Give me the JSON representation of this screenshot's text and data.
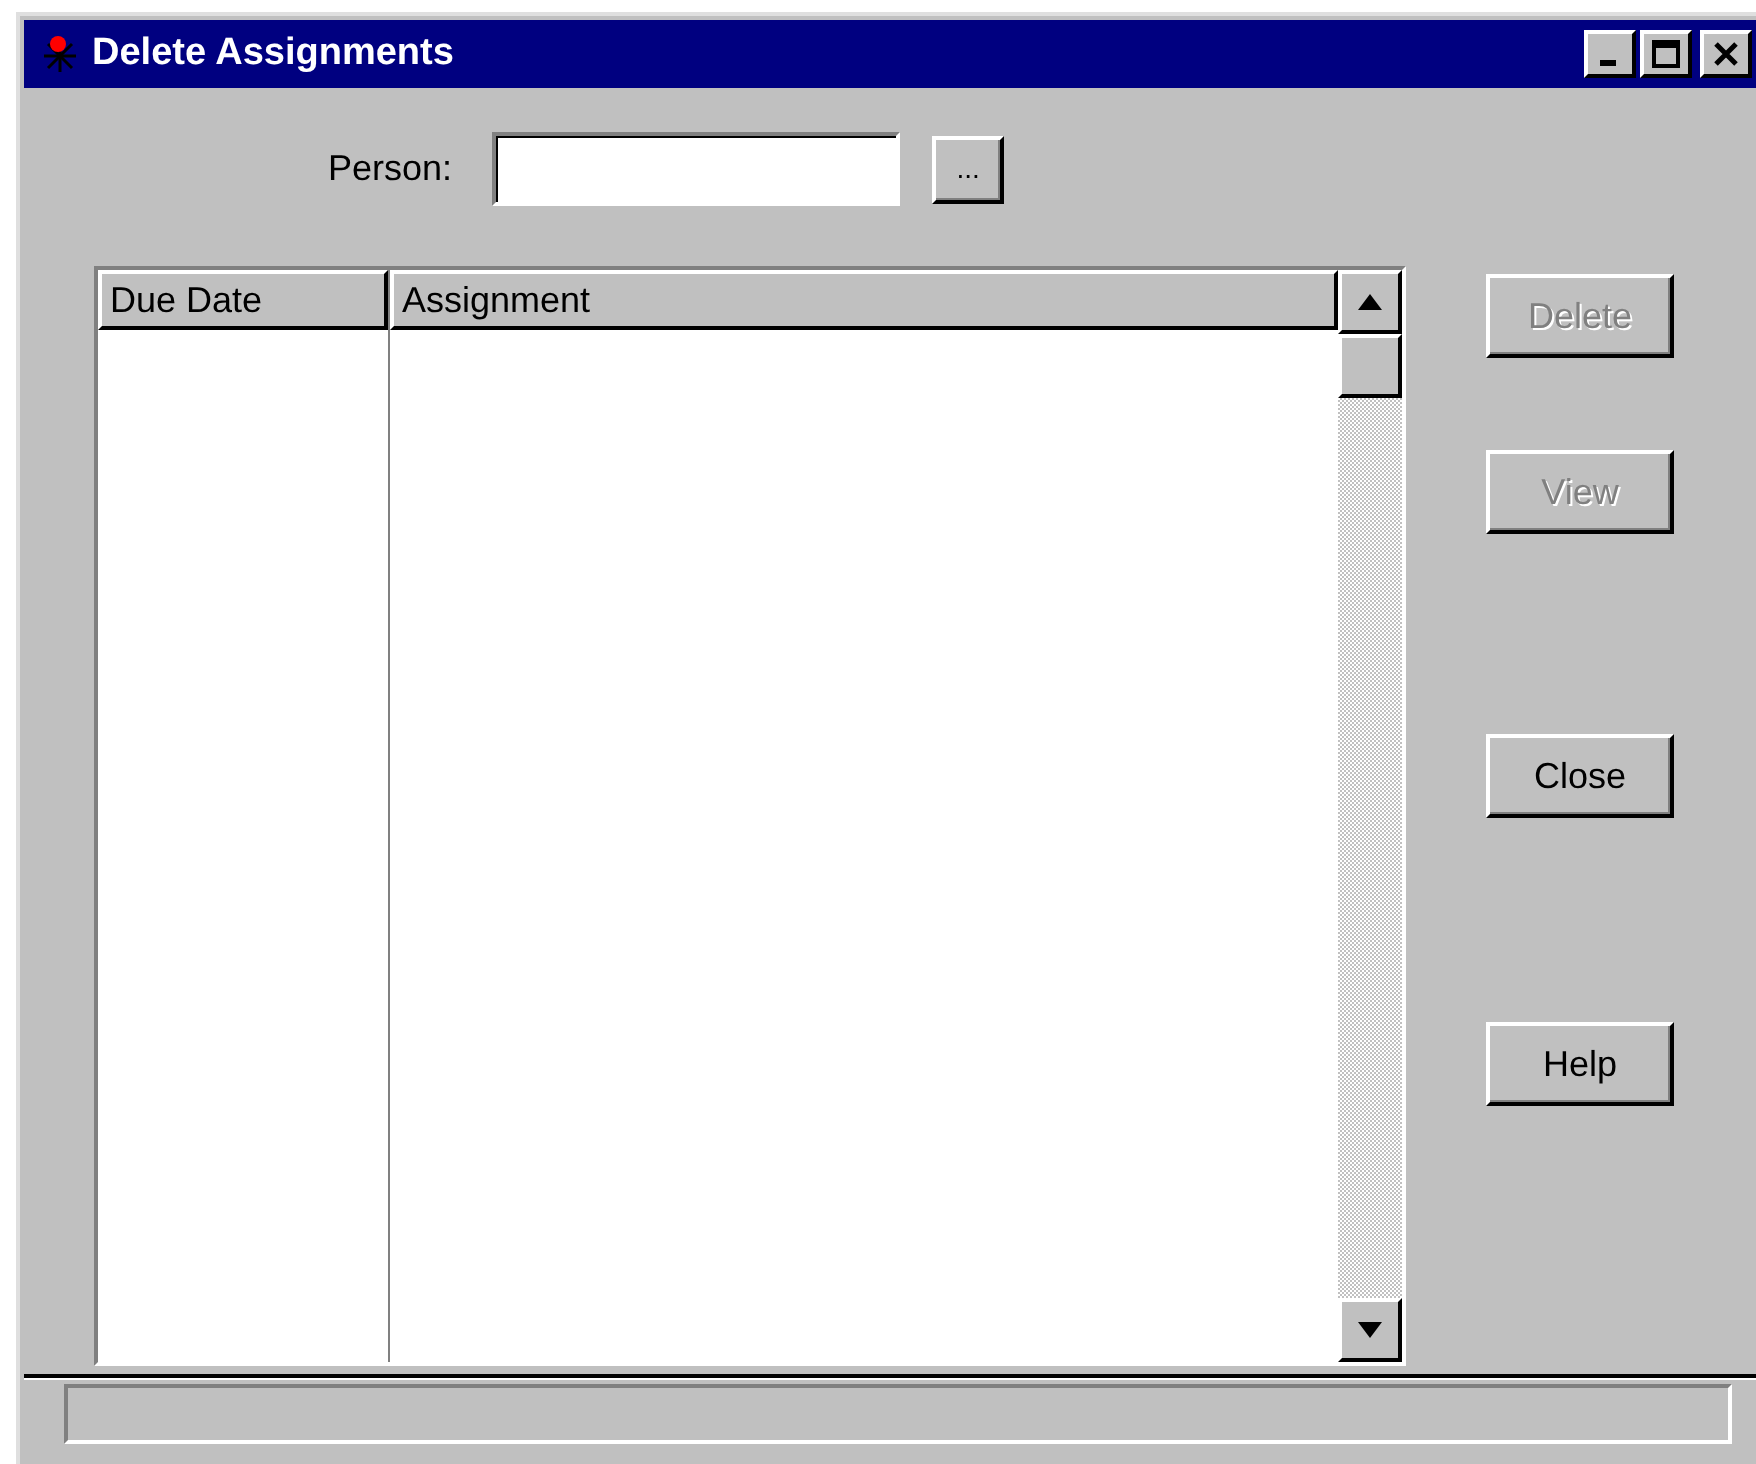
{
  "window": {
    "title": "Delete Assignments"
  },
  "person": {
    "label": "Person:",
    "browse_button": "..."
  },
  "table": {
    "columns": [
      "Due Date",
      "Assignment"
    ]
  },
  "buttons": [
    {
      "label": "Delete",
      "disabled": true
    },
    {
      "label": "View",
      "disabled": true
    },
    {
      "label": "Close",
      "disabled": false
    },
    {
      "label": "Help",
      "disabled": false
    }
  ]
}
